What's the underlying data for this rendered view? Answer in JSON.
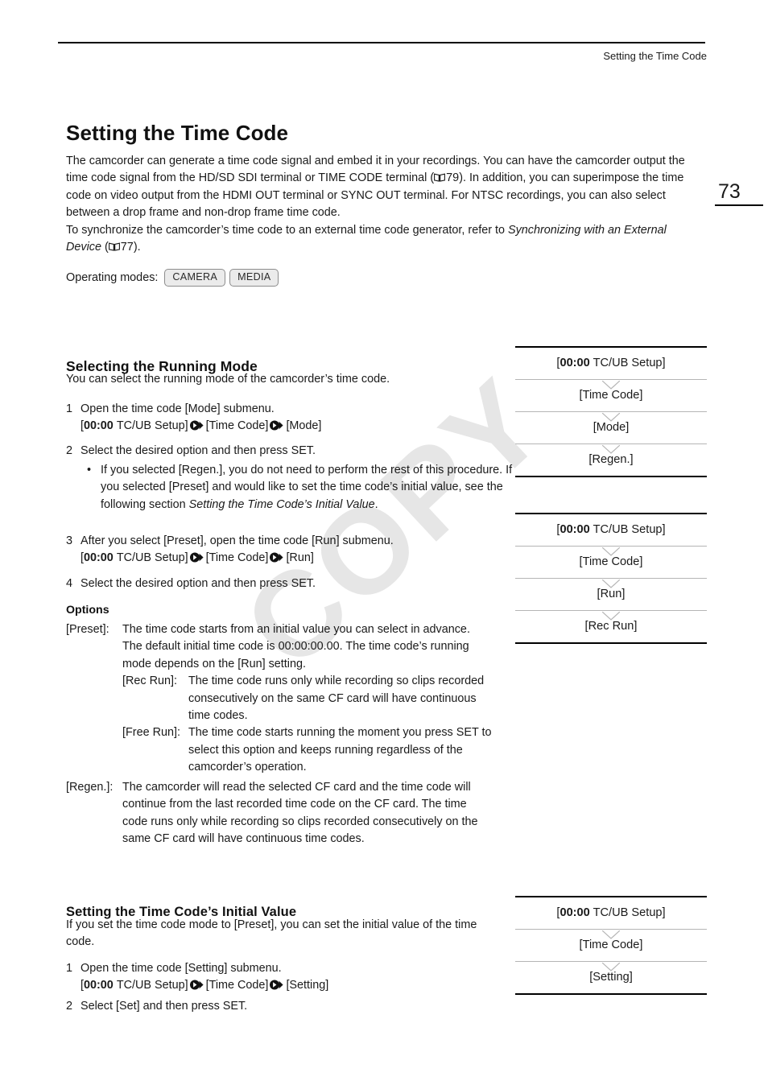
{
  "header": {
    "running_head": "Setting the Time Code",
    "page_number": "73"
  },
  "title": "Setting the Time Code",
  "intro": {
    "p1_a": "The camcorder can generate a time code signal and embed it in your recordings. You can have the camcorder output the time code signal from the HD/SD SDI terminal or TIME CODE terminal (",
    "p1_ref": "79",
    "p1_b": "). In addition, you can superimpose the time code on video output from the HDMI OUT terminal or SYNC OUT terminal. For NTSC recordings, you can also select between a drop frame and non-drop frame time code.",
    "p2_a": "To synchronize the camcorder’s time code to an external time code generator, refer to ",
    "p2_italic": "Synchronizing with an External Device",
    "p2_b": " (",
    "p2_ref": "77",
    "p2_c": ")."
  },
  "operating_modes": {
    "label": "Operating modes:",
    "badges": [
      "CAMERA",
      "MEDIA"
    ]
  },
  "section1": {
    "heading": "Selecting the Running Mode",
    "intro": "You can select the running mode of the camcorder’s time code.",
    "steps": [
      {
        "num": "1",
        "text": "Open the time code [Mode] submenu.",
        "path": [
          "TC/UB Setup]",
          "[Time Code]",
          "[Mode]"
        ],
        "path_prefix": "[",
        "tc_icon": "00:00"
      },
      {
        "num": "2",
        "text": "Select the desired option and then press SET."
      },
      {
        "num": "3",
        "text": "After you select [Preset], open the time code [Run] submenu.",
        "path": [
          "TC/UB Setup]",
          "[Time Code]",
          "[Run]"
        ],
        "path_prefix": "[",
        "tc_icon": "00:00"
      },
      {
        "num": "4",
        "text": "Select the desired option and then press SET."
      }
    ],
    "bullet": {
      "a": "If you selected [Regen.], you do not need to perform the rest of this procedure. If you selected [Preset] and would like to set the time code’s initial value, see the following section ",
      "italic": "Setting the Time Code’s Initial Value",
      "b": "."
    }
  },
  "options": {
    "heading": "Options",
    "preset": {
      "key": "[Preset]:",
      "text": "The time code starts from an initial value you can select in advance. The default initial time code is 00:00:00.00. The time code’s running mode depends on the [Run] setting.",
      "rec_run": {
        "key": "[Rec Run]:",
        "text": "The time code runs only while recording so clips recorded consecutively on the same CF card will have continuous time codes."
      },
      "free_run": {
        "key": "[Free Run]:",
        "text": "The time code starts running the moment you press SET to select this option and keeps running regardless of the camcorder’s operation."
      }
    },
    "regen": {
      "key": "[Regen.]:",
      "text": "The camcorder will read the selected CF card and the time code will continue from the last recorded time code on the CF card. The time code runs only while recording so clips recorded consecutively on the same CF card will have continuous time codes."
    }
  },
  "section2": {
    "heading": "Setting the Time Code’s Initial Value",
    "intro": "If you set the time code mode to [Preset], you can set the initial value of the time code.",
    "steps": [
      {
        "num": "1",
        "text": "Open the time code [Setting] submenu.",
        "path": [
          "TC/UB Setup]",
          "[Time Code]",
          "[Setting]"
        ],
        "tc_icon": "00:00"
      },
      {
        "num": "2",
        "text": "Select [Set] and then press SET."
      }
    ]
  },
  "menu_diagrams": [
    {
      "tc_icon": "00:00",
      "items": [
        "[00:00 TC/UB Setup]",
        "[Time Code]",
        "[Mode]",
        "[Regen.]"
      ],
      "first_prefix": "[",
      "first_rest": " TC/UB Setup]"
    },
    {
      "tc_icon": "00:00",
      "items": [
        "[00:00 TC/UB Setup]",
        "[Time Code]",
        "[Run]",
        "[Rec Run]"
      ],
      "first_prefix": "[",
      "first_rest": " TC/UB Setup]"
    },
    {
      "tc_icon": "00:00",
      "items": [
        "[00:00 TC/UB Setup]",
        "[Time Code]",
        "[Setting]"
      ],
      "first_prefix": "[",
      "first_rest": " TC/UB Setup]"
    }
  ],
  "watermark": "COPY",
  "colors": {
    "rule": "#000000",
    "separator": "#b5b5b5",
    "badge_bg": "#ebebeb",
    "watermark": "#e6e6e6"
  }
}
